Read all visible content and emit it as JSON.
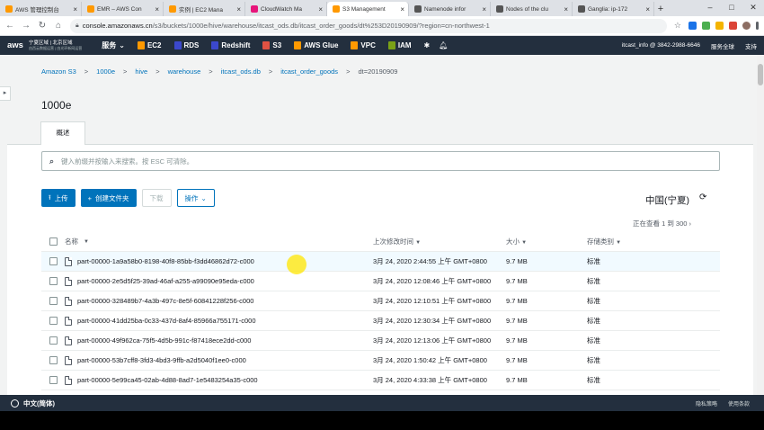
{
  "browser": {
    "tabs": [
      {
        "title": "AWS 管理控制台",
        "color": "#ff9900",
        "active": false
      },
      {
        "title": "EMR – AWS Con",
        "color": "#ff9900",
        "active": false
      },
      {
        "title": "实例 | EC2 Mana",
        "color": "#ff9900",
        "active": false
      },
      {
        "title": "CloudWatch Ma",
        "color": "#e7157b",
        "active": false
      },
      {
        "title": "S3 Management",
        "color": "#ff9900",
        "active": true
      },
      {
        "title": "Namenode infor",
        "color": "#555555",
        "active": false
      },
      {
        "title": "Nodes of the clu",
        "color": "#555555",
        "active": false
      },
      {
        "title": "Ganglia: ip-172",
        "color": "#555555",
        "active": false
      }
    ],
    "new_tab": "+",
    "window_controls": [
      "–",
      "□",
      "✕"
    ],
    "url_host": "console.amazonaws.cn",
    "url_path": "/s3/buckets/1000e/hive/warehouse/itcast_ods.db/itcast_order_goods/dt%253D20190909/?region=cn-northwest-1"
  },
  "awsnav": {
    "logo": "aws",
    "region_line1": "宁夏区域 | 北京区域",
    "region_line2": "由西云数据运营 | 由光环新网运营",
    "services": "服务",
    "items": [
      {
        "label": "EC2",
        "color": "#ff9900"
      },
      {
        "label": "RDS",
        "color": "#3b48cc"
      },
      {
        "label": "Redshift",
        "color": "#3b48cc"
      },
      {
        "label": "S3",
        "color": "#e05243"
      },
      {
        "label": "AWS Glue",
        "color": "#ff9900"
      },
      {
        "label": "VPC",
        "color": "#ff9900"
      },
      {
        "label": "IAM",
        "color": "#7aa116"
      }
    ],
    "account": "itcast_info @ 3842-2988-6646",
    "global_services": "服务全球",
    "support": "支持"
  },
  "breadcrumb": {
    "items": [
      "Amazon S3",
      "1000e",
      "hive",
      "warehouse",
      "itcast_ods.db",
      "itcast_order_goods",
      "dt=20190909"
    ],
    "separator": ">"
  },
  "bucket": {
    "name": "1000e",
    "tab_overview": "概述"
  },
  "search": {
    "placeholder": "键入前缀并按输入来搜索。按 ESC 可清除。"
  },
  "actions": {
    "upload": "上传",
    "create_folder": "创建文件夹",
    "download": "下载",
    "actions": "操作"
  },
  "region_display": "中国(宁夏)",
  "viewing": "正在查看 1 到 300",
  "table": {
    "headers": {
      "name": "名称",
      "modified": "上次修改时间",
      "size": "大小",
      "storage_class": "存储类别"
    },
    "rows": [
      {
        "name": "part-00000-1a9a58b0-8198-40f8-85bb-f3dd46862d72-c000",
        "modified": "3月 24, 2020 2:44:55 上午 GMT+0800",
        "size": "9.7 MB",
        "storage_class": "标准"
      },
      {
        "name": "part-00000-2e5d5f25-39ad-46af-a255-a99090e95eda-c000",
        "modified": "3月 24, 2020 12:08:46 上午 GMT+0800",
        "size": "9.7 MB",
        "storage_class": "标准"
      },
      {
        "name": "part-00000-328489b7-4a3b-497c-8e5f-60841228f256-c000",
        "modified": "3月 24, 2020 12:10:51 上午 GMT+0800",
        "size": "9.7 MB",
        "storage_class": "标准"
      },
      {
        "name": "part-00000-41dd25ba-0c33-437d-8af4-85966a755171-c000",
        "modified": "3月 24, 2020 12:30:34 上午 GMT+0800",
        "size": "9.7 MB",
        "storage_class": "标准"
      },
      {
        "name": "part-00000-49f962ca-75f5-4d5b-991c-f87418ece2dd-c000",
        "modified": "3月 24, 2020 12:13:06 上午 GMT+0800",
        "size": "9.7 MB",
        "storage_class": "标准"
      },
      {
        "name": "part-00000-53b7cff8-3fd3-4bd3-9ffb-a2d5040f1ee0-c000",
        "modified": "3月 24, 2020 1:50:42 上午 GMT+0800",
        "size": "9.7 MB",
        "storage_class": "标准"
      },
      {
        "name": "part-00000-5e99ca45-02ab-4d88-8ad7-1e5483254a35-c000",
        "modified": "3月 24, 2020 4:33:38 上午 GMT+0800",
        "size": "9.7 MB",
        "storage_class": "标准"
      }
    ]
  },
  "footer": {
    "language": "中文(简体)",
    "privacy": "隐私策略",
    "terms": "使用条款"
  }
}
